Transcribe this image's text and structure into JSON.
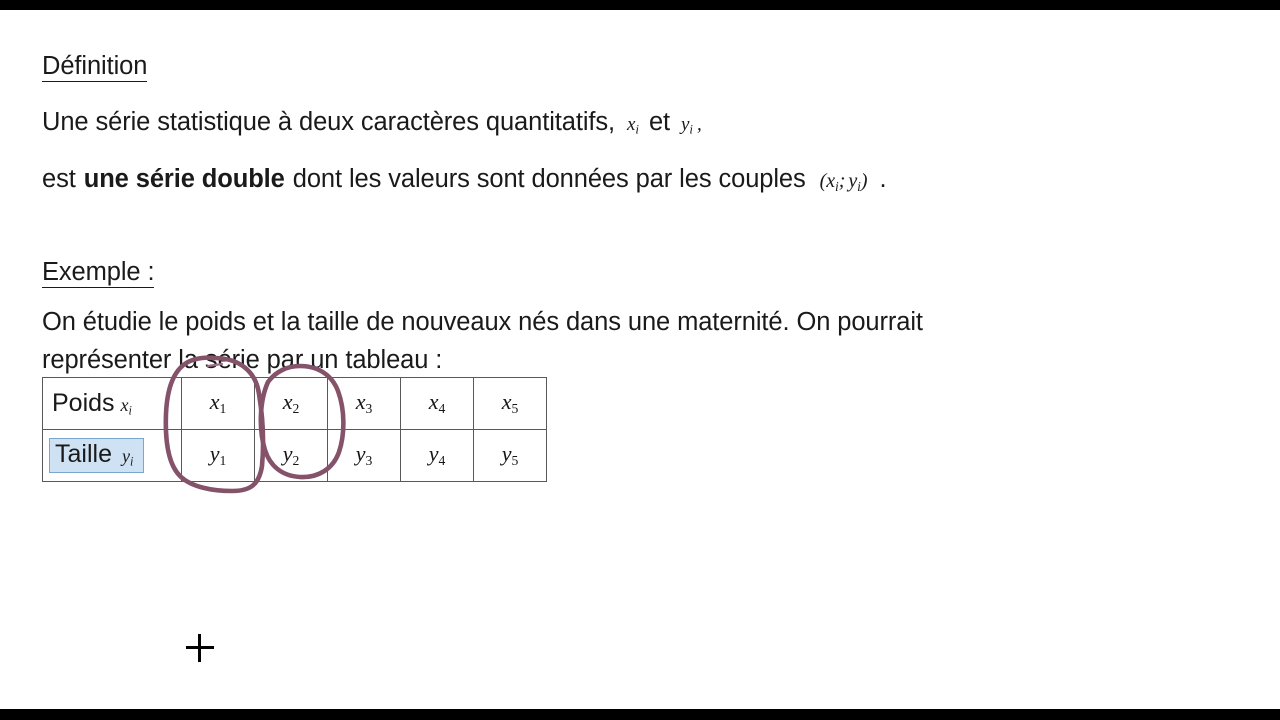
{
  "slide": {
    "background_color": "#ffffff",
    "letterbox_color": "#000000",
    "definition": {
      "heading": "Définition",
      "line1_part1": "Une série statistique à deux caractères quantitatifs,",
      "line1_math1_base": "x",
      "line1_math1_sub": "i",
      "line1_mid": "et",
      "line1_math2_base": "y",
      "line1_math2_sub": "i",
      "line1_end": ",",
      "line2_part1": "est",
      "line2_bold": "une série double",
      "line2_part2": "dont les valeurs sont données par les couples",
      "line2_couple_open": "(",
      "line2_couple_x_base": "x",
      "line2_couple_x_sub": "i",
      "line2_couple_sep": ";",
      "line2_couple_y_base": "y",
      "line2_couple_y_sub": "i",
      "line2_couple_close": ")",
      "line2_end": "."
    },
    "exemple": {
      "heading": "Exemple  :",
      "line1": "On étudie le poids et la taille de nouveaux nés dans une maternité. On pourrait",
      "line2": "représenter la série par un tableau :"
    },
    "table": {
      "rows": [
        {
          "label": "Poids",
          "label_math_base": "x",
          "label_math_sub": "i",
          "highlighted": false,
          "cells": [
            {
              "base": "x",
              "sub": "1"
            },
            {
              "base": "x",
              "sub": "2"
            },
            {
              "base": "x",
              "sub": "3"
            },
            {
              "base": "x",
              "sub": "4"
            },
            {
              "base": "x",
              "sub": "5"
            }
          ]
        },
        {
          "label": "Taille",
          "label_math_base": "y",
          "label_math_sub": "i",
          "highlighted": true,
          "highlight_fill": "#cfe2f3",
          "highlight_border": "#7aa6cf",
          "cells": [
            {
              "base": "y",
              "sub": "1"
            },
            {
              "base": "y",
              "sub": "2"
            },
            {
              "base": "y",
              "sub": "3"
            },
            {
              "base": "y",
              "sub": "4"
            },
            {
              "base": "y",
              "sub": "5"
            }
          ]
        }
      ],
      "border_color": "#595959"
    },
    "annotation": {
      "ink_color": "#84536a",
      "shapes": "two hand-drawn ovals circling the first and second data columns"
    },
    "cursor": {
      "glyph": "plus",
      "color": "#000000"
    }
  }
}
